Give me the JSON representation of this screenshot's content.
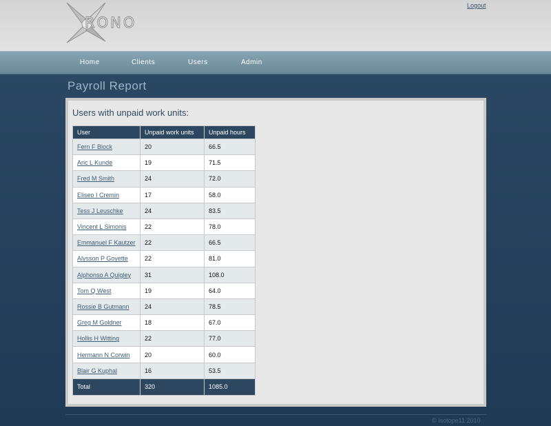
{
  "header": {
    "logo_text": "RONO",
    "logout_label": "Logout"
  },
  "nav": {
    "items": [
      {
        "label": "Home"
      },
      {
        "label": "Clients"
      },
      {
        "label": "Users"
      },
      {
        "label": "Admin"
      }
    ]
  },
  "page": {
    "title": "Payroll Report",
    "heading": "Users with unpaid work units:"
  },
  "table": {
    "headers": [
      "User",
      "Unpaid work units",
      "Unpaid hours"
    ],
    "rows": [
      {
        "user": "Fern F Block",
        "units": "20",
        "hours": "66.5"
      },
      {
        "user": "Aric L Kunde",
        "units": "19",
        "hours": "71.5"
      },
      {
        "user": "Fred M Smith",
        "units": "24",
        "hours": "72.0"
      },
      {
        "user": "Eliseo I Cremin",
        "units": "17",
        "hours": "58.0"
      },
      {
        "user": "Tess J Leuschke",
        "units": "24",
        "hours": "83.5"
      },
      {
        "user": "Vincent L Simonis",
        "units": "22",
        "hours": "78.0"
      },
      {
        "user": "Emmanuel F Kautzer",
        "units": "22",
        "hours": "66.5"
      },
      {
        "user": "Alysson P Goyette",
        "units": "22",
        "hours": "81.0"
      },
      {
        "user": "Alphonso A Quigley",
        "units": "31",
        "hours": "108.0"
      },
      {
        "user": "Tom Q West",
        "units": "19",
        "hours": "64.0"
      },
      {
        "user": "Rossie B Gutmann",
        "units": "24",
        "hours": "78.5"
      },
      {
        "user": "Greg M Goldner",
        "units": "18",
        "hours": "67.0"
      },
      {
        "user": "Hollis H Witting",
        "units": "22",
        "hours": "77.0"
      },
      {
        "user": "Hermann N Corwin",
        "units": "20",
        "hours": "60.0"
      },
      {
        "user": "Blair G Kuphal",
        "units": "16",
        "hours": "53.5"
      }
    ],
    "total": {
      "label": "Total",
      "units": "320",
      "hours": "1085.0"
    }
  },
  "footer": {
    "text": "© Isotope11 2010"
  }
}
